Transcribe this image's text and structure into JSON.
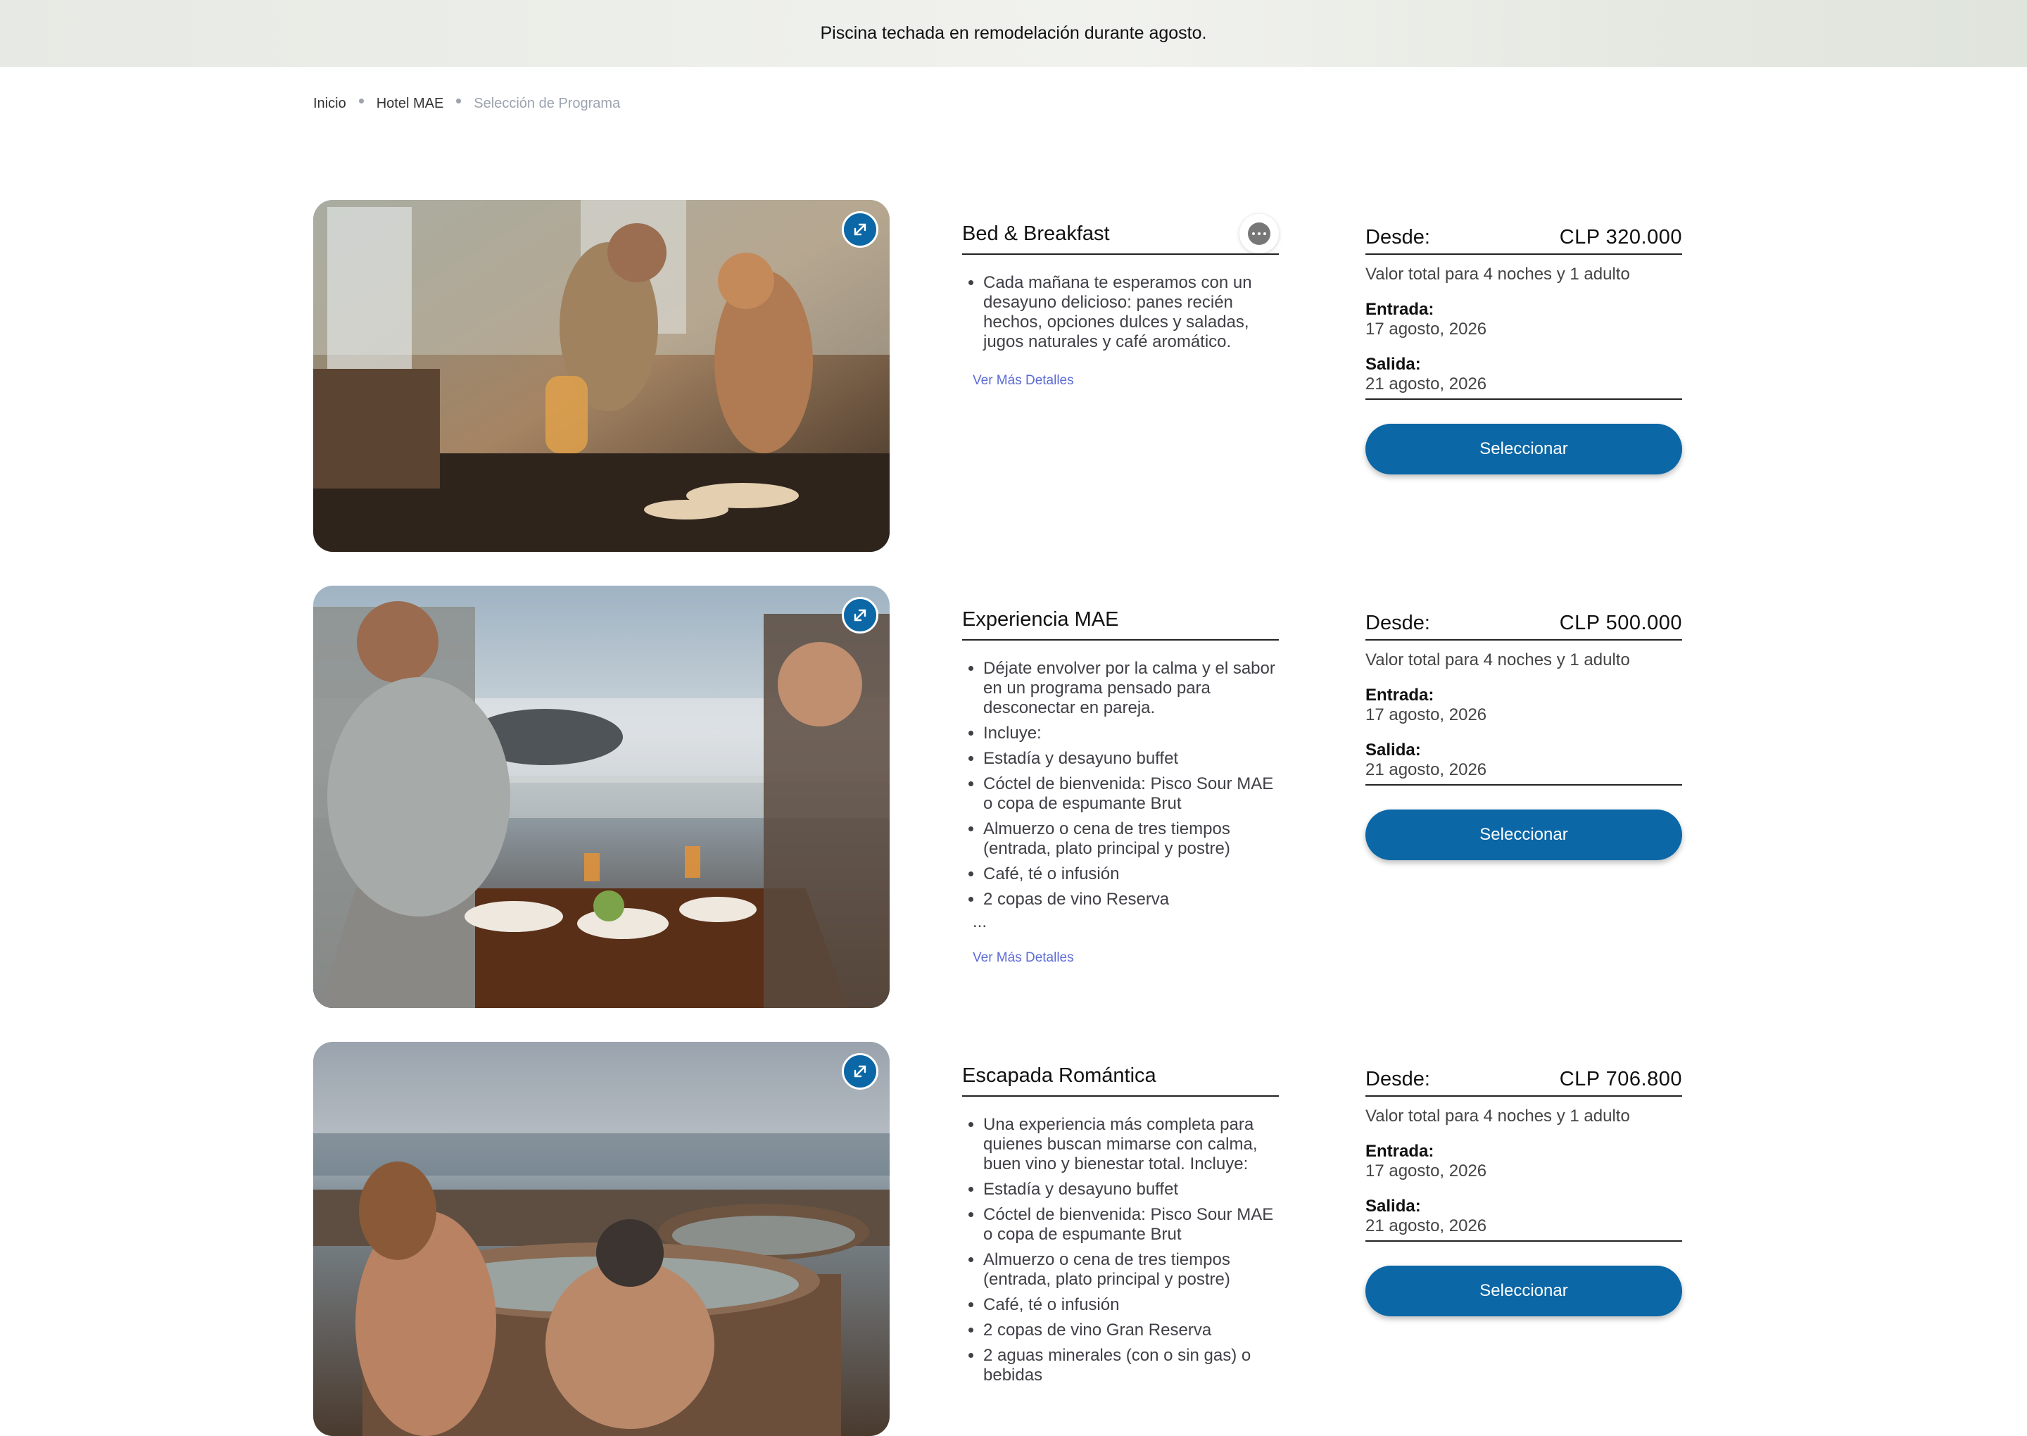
{
  "banner": {
    "text": "Piscina techada en remodelación durante agosto."
  },
  "breadcrumb": [
    "Inicio",
    "Hotel MAE",
    "Selección de Programa"
  ],
  "colors": {
    "primary": "#0b67a6",
    "link": "#5b6bd6"
  },
  "programs": [
    {
      "title": "Bed & Breakfast",
      "has_chat": true,
      "features": [
        "Cada mañana te esperamos con un desayuno delicioso: panes recién hechos, opciones dulces y saladas, jugos naturales y café aromático."
      ],
      "ellipsis": "",
      "more_label": "Ver Más Detalles",
      "price": {
        "from_label": "Desde:",
        "amount": "CLP 320.000",
        "valor": "Valor total para 4 noches y 1 adulto",
        "entrada_label": "Entrada:",
        "entrada": "17 agosto, 2026",
        "salida_label": "Salida:",
        "salida": "21 agosto, 2026",
        "button": "Seleccionar"
      }
    },
    {
      "title": "Experiencia MAE",
      "has_chat": false,
      "features": [
        "Déjate envolver por la calma y el sabor en un programa pensado para desconectar en pareja.",
        "Incluye:",
        "Estadía y desayuno buffet",
        "Cóctel de bienvenida: Pisco Sour MAE o copa de espumante Brut",
        "Almuerzo o cena de tres tiempos (entrada, plato principal y postre)",
        "Café, té o infusión",
        "2 copas de vino Reserva"
      ],
      "ellipsis": "...",
      "more_label": "Ver Más Detalles",
      "price": {
        "from_label": "Desde:",
        "amount": "CLP 500.000",
        "valor": "Valor total para 4 noches y 1 adulto",
        "entrada_label": "Entrada:",
        "entrada": "17 agosto, 2026",
        "salida_label": "Salida:",
        "salida": "21 agosto, 2026",
        "button": "Seleccionar"
      }
    },
    {
      "title": "Escapada Romántica",
      "has_chat": false,
      "features": [
        "Una experiencia más completa para quienes buscan mimarse con calma, buen vino y bienestar total. Incluye:",
        "Estadía y desayuno buffet",
        "Cóctel de bienvenida: Pisco Sour MAE o copa de espumante Brut",
        "Almuerzo o cena de tres tiempos (entrada, plato principal y postre)",
        "Café, té o infusión",
        "2 copas de vino Gran Reserva",
        "2 aguas minerales (con o sin gas) o bebidas"
      ],
      "ellipsis": "",
      "more_label": "",
      "price": {
        "from_label": "Desde:",
        "amount": "CLP 706.800",
        "valor": "Valor total para 4 noches y 1 adulto",
        "entrada_label": "Entrada:",
        "entrada": "17 agosto, 2026",
        "salida_label": "Salida:",
        "salida": "21 agosto, 2026",
        "button": "Seleccionar"
      }
    }
  ]
}
